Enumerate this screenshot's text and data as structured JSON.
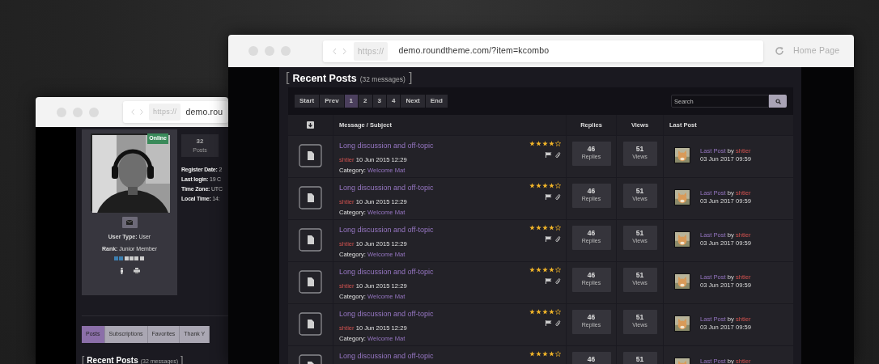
{
  "back_window": {
    "url_scheme": "https://",
    "url": "demo.rou",
    "profile": {
      "status": "Online",
      "user_type": "**User Type:** User",
      "rank": "**Rank:** Junior Member",
      "level": 0.333,
      "stat": {
        "value": "32",
        "label": "Posts"
      },
      "details": [
        "**Register Date:** 2",
        "**Last login:** 19 C",
        "**Time Zone:** UTC",
        "**Local Time:** 14:"
      ]
    },
    "tabs": [
      {
        "label": "Posts",
        "selected": true
      },
      {
        "label": "Subscriptions",
        "selected": false
      },
      {
        "label": "Favorites",
        "selected": false
      },
      {
        "label": "Thank Y",
        "selected": false
      }
    ],
    "heading": {
      "open": "[",
      "title": "Recent Posts",
      "count": "(32 messages)",
      "close": "]"
    }
  },
  "front_window": {
    "url_scheme": "https://",
    "url": "demo.roundtheme.com/?item=kcombo",
    "home": "Home Page",
    "heading": {
      "open": "[",
      "title": "Recent Posts",
      "count": "(32 messages)",
      "close": "]"
    },
    "pagination": [
      {
        "label": "Start",
        "selected": false
      },
      {
        "label": "Prev",
        "selected": false
      },
      {
        "label": "1",
        "selected": true
      },
      {
        "label": "2",
        "selected": false
      },
      {
        "label": "3",
        "selected": false
      },
      {
        "label": "4",
        "selected": false
      },
      {
        "label": "Next",
        "selected": false
      },
      {
        "label": "End",
        "selected": false
      }
    ],
    "search": {
      "placeholder": "Search"
    },
    "columns": [
      "Message / Subject",
      "Replies",
      "Views",
      "Last Post"
    ],
    "rows": [
      {
        "title": "Long discussion and off-topic",
        "author": "shtier",
        "date": "10 Jun 2015 12:29",
        "category_label": "Category:",
        "category": "Welcome Mat",
        "stars": 4,
        "replies": "46",
        "replies_label": "Replies",
        "views": "51",
        "views_label": "Views",
        "last_post": "Last Post",
        "by": "by",
        "last_author": "shtier",
        "last_date": "03 Jun 2017 09:59"
      },
      {
        "title": "Long discussion and off-topic",
        "author": "shtier",
        "date": "10 Jun 2015 12:29",
        "category_label": "Category:",
        "category": "Welcome Mat",
        "stars": 4,
        "replies": "46",
        "replies_label": "Replies",
        "views": "51",
        "views_label": "Views",
        "last_post": "Last Post",
        "by": "by",
        "last_author": "shtier",
        "last_date": "03 Jun 2017 09:59"
      },
      {
        "title": "Long discussion and off-topic",
        "author": "shtier",
        "date": "10 Jun 2015 12:29",
        "category_label": "Category:",
        "category": "Welcome Mat",
        "stars": 4,
        "replies": "46",
        "replies_label": "Replies",
        "views": "51",
        "views_label": "Views",
        "last_post": "Last Post",
        "by": "by",
        "last_author": "shtier",
        "last_date": "03 Jun 2017 09:59"
      },
      {
        "title": "Long discussion and off-topic",
        "author": "shtier",
        "date": "10 Jun 2015 12:29",
        "category_label": "Category:",
        "category": "Welcome Mat",
        "stars": 4,
        "replies": "46",
        "replies_label": "Replies",
        "views": "51",
        "views_label": "Views",
        "last_post": "Last Post",
        "by": "by",
        "last_author": "shtier",
        "last_date": "03 Jun 2017 09:59"
      },
      {
        "title": "Long discussion and off-topic",
        "author": "shtier",
        "date": "10 Jun 2015 12:29",
        "category_label": "Category:",
        "category": "Welcome Mat",
        "stars": 4,
        "replies": "46",
        "replies_label": "Replies",
        "views": "51",
        "views_label": "Views",
        "last_post": "Last Post",
        "by": "by",
        "last_author": "shtier",
        "last_date": "03 Jun 2017 09:59"
      },
      {
        "title": "Long discussion and off-topic",
        "stars": 4,
        "replies": "46",
        "views": "51",
        "last_post": "Last Post",
        "by": "by",
        "last_author": "shtier"
      }
    ]
  }
}
